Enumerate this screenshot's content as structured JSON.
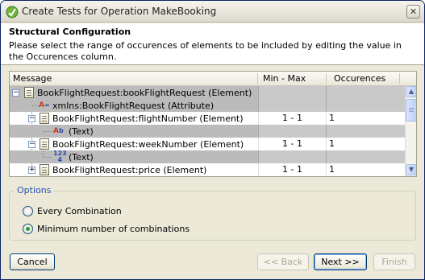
{
  "window": {
    "title": "Create Tests for Operation MakeBooking"
  },
  "header": {
    "title": "Structural Configuration",
    "description": "Please select the range of occurences of elements to be included by editing the value in the Occurences column."
  },
  "table": {
    "columns": {
      "message": "Message",
      "minmax": "Min - Max",
      "occurences": "Occurences"
    },
    "rows": [
      {
        "label": "BookFlightRequest:bookFlightRequest (Element)",
        "minmax": "",
        "occ": ""
      },
      {
        "label": "xmlns:BookFlightRequest (Attribute)",
        "minmax": "",
        "occ": ""
      },
      {
        "label": "BookFlightRequest:flightNumber (Element)",
        "minmax": "1 - 1",
        "occ": "1"
      },
      {
        "label": "(Text)",
        "minmax": "",
        "occ": ""
      },
      {
        "label": "BookFlightRequest:weekNumber (Element)",
        "minmax": "1 - 1",
        "occ": "1"
      },
      {
        "label": "(Text)",
        "minmax": "",
        "occ": ""
      },
      {
        "label": "BookFlightRequest:price (Element)",
        "minmax": "1 - 1",
        "occ": "1"
      }
    ]
  },
  "options": {
    "legend": "Options",
    "every": "Every Combination",
    "minimum": "Minimum number of combinations",
    "selected": "minimum"
  },
  "buttons": {
    "cancel": "Cancel",
    "back": "<< Back",
    "next": "Next >>",
    "finish": "Finish"
  },
  "colors": {
    "accent": "#2450b4",
    "selection": "#bbbbbb",
    "radio_dot": "#21a121"
  }
}
